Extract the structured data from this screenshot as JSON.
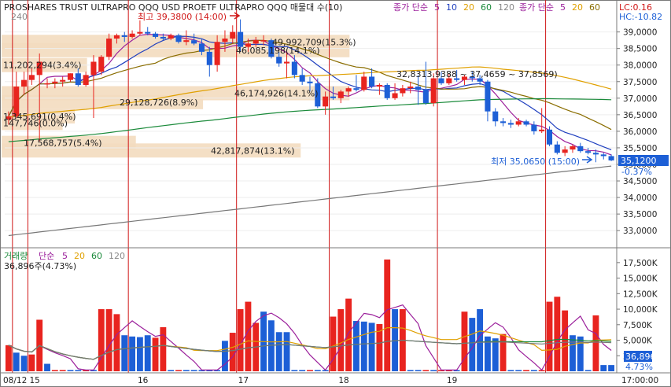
{
  "chart_data": {
    "type": "candlestick+volume",
    "instrument_title": "PROSHARES TRUST ULTRAPRO QQQ USD  PROETF ULTRAPRO QQQ 매물대 수(10)",
    "legend_price": [
      {
        "label": "종가 단순",
        "color": "#9b1f9b"
      },
      {
        "label": "5",
        "color": "#9b1f9b"
      },
      {
        "label": "10",
        "color": "#1f3fbf"
      },
      {
        "label": "20",
        "color": "#e0a000"
      },
      {
        "label": "60",
        "color": "#1a8a3a"
      },
      {
        "label": "120",
        "color": "#888888"
      },
      {
        "label": "240",
        "color": "#888888"
      }
    ],
    "legend_price_right": [
      {
        "label": "종가 단순",
        "color": "#9b1f9b"
      },
      {
        "label": "5",
        "color": "#9b1f9b"
      },
      {
        "label": "20",
        "color": "#e0a000"
      },
      {
        "label": "60",
        "color": "#8a6d00"
      }
    ],
    "lc_label": "LC:0.16",
    "hc_label": "HC:-10.82",
    "price_ylim": [
      32600,
      39300
    ],
    "price_ticks": [
      "39,0000",
      "38,5000",
      "38,0000",
      "37,5000",
      "37,0000",
      "36,5000",
      "36,0000",
      "35,5000",
      "35,0000",
      "34,5000",
      "34,0000",
      "33,5000",
      "33,0000"
    ],
    "price_tick_values": [
      39000,
      38500,
      38000,
      37500,
      37000,
      36500,
      36000,
      35500,
      35000,
      34500,
      34000,
      33500,
      33000
    ],
    "current_price": "35,1200",
    "current_change": "-0.37%",
    "high_label": "최고 39,3800 (14:00)",
    "low_label": "최저 35,0650 (15:00)",
    "range_label": "32,8313.9388 ~ 37,4659 ~ 37,8569)",
    "volume_profile": [
      {
        "label": "49,992,709(15.3%)",
        "price": 38700
      },
      {
        "label": "46,085,198(14.1%)",
        "price": 38450
      },
      {
        "label": "11,202,294(3.4%)",
        "price": 38000
      },
      {
        "label": "46,174,926(14.1%)",
        "price": 37150
      },
      {
        "label": "29,128,726(8.9%)",
        "price": 36880
      },
      {
        "label": "1,345,691(0.4%)",
        "price": 36450
      },
      {
        "label": "147,746(0.0%)",
        "price": 36250
      },
      {
        "label": "17,568,757(5.4%)",
        "price": 35650
      },
      {
        "label": "42,817,874(13.1%)",
        "price": 35420
      }
    ],
    "candles": [
      {
        "o": 36350,
        "h": 36600,
        "l": 36200,
        "c": 36450
      },
      {
        "o": 36450,
        "h": 37800,
        "l": 36400,
        "c": 37350
      },
      {
        "o": 37350,
        "h": 37800,
        "l": 37100,
        "c": 37550
      },
      {
        "o": 37550,
        "h": 37900,
        "l": 37400,
        "c": 37700
      },
      {
        "o": 37700,
        "h": 38350,
        "l": 35700,
        "c": 38100
      },
      {
        "o": 37450,
        "h": 37600,
        "l": 37300,
        "c": 37450
      },
      {
        "o": 37450,
        "h": 37600,
        "l": 37300,
        "c": 37500
      },
      {
        "o": 37500,
        "h": 37650,
        "l": 37350,
        "c": 37550
      },
      {
        "o": 37550,
        "h": 37750,
        "l": 37500,
        "c": 37750
      },
      {
        "o": 37750,
        "h": 37900,
        "l": 37350,
        "c": 37400
      },
      {
        "o": 37400,
        "h": 37800,
        "l": 37350,
        "c": 37700
      },
      {
        "o": 37700,
        "h": 38300,
        "l": 36400,
        "c": 38100
      },
      {
        "o": 37800,
        "h": 38300,
        "l": 37700,
        "c": 38250
      },
      {
        "o": 38250,
        "h": 38950,
        "l": 38150,
        "c": 38800
      },
      {
        "o": 38800,
        "h": 38950,
        "l": 38650,
        "c": 38900
      },
      {
        "o": 38900,
        "h": 39000,
        "l": 38700,
        "c": 38850
      },
      {
        "o": 38850,
        "h": 39050,
        "l": 38800,
        "c": 38950
      },
      {
        "o": 38950,
        "h": 39350,
        "l": 38900,
        "c": 39000
      },
      {
        "o": 39000,
        "h": 39150,
        "l": 38900,
        "c": 38950
      },
      {
        "o": 38950,
        "h": 39000,
        "l": 38800,
        "c": 38850
      },
      {
        "o": 38850,
        "h": 38950,
        "l": 38750,
        "c": 38800
      },
      {
        "o": 38800,
        "h": 38950,
        "l": 38750,
        "c": 38900
      },
      {
        "o": 38900,
        "h": 38950,
        "l": 38650,
        "c": 38700
      },
      {
        "o": 38700,
        "h": 39050,
        "l": 38600,
        "c": 38750
      },
      {
        "o": 38750,
        "h": 38950,
        "l": 38600,
        "c": 38650
      },
      {
        "o": 38650,
        "h": 38800,
        "l": 38300,
        "c": 38400
      },
      {
        "o": 38400,
        "h": 38550,
        "l": 37650,
        "c": 38000
      },
      {
        "o": 38000,
        "h": 38900,
        "l": 37800,
        "c": 38700
      },
      {
        "o": 38700,
        "h": 39050,
        "l": 38400,
        "c": 38800
      },
      {
        "o": 38800,
        "h": 39200,
        "l": 38650,
        "c": 39000
      },
      {
        "o": 39000,
        "h": 39380,
        "l": 38400,
        "c": 38550
      },
      {
        "o": 38550,
        "h": 38800,
        "l": 38400,
        "c": 38650
      },
      {
        "o": 38650,
        "h": 38850,
        "l": 38550,
        "c": 38750
      },
      {
        "o": 38750,
        "h": 38900,
        "l": 38600,
        "c": 38750
      },
      {
        "o": 38750,
        "h": 38800,
        "l": 38200,
        "c": 38250
      },
      {
        "o": 38250,
        "h": 38400,
        "l": 37950,
        "c": 38050
      },
      {
        "o": 38050,
        "h": 38400,
        "l": 37600,
        "c": 38100
      },
      {
        "o": 38100,
        "h": 38300,
        "l": 37600,
        "c": 37700
      },
      {
        "o": 37700,
        "h": 37900,
        "l": 37400,
        "c": 37500
      },
      {
        "o": 37500,
        "h": 37650,
        "l": 37200,
        "c": 37450
      },
      {
        "o": 37450,
        "h": 37600,
        "l": 36700,
        "c": 36750
      },
      {
        "o": 36750,
        "h": 37200,
        "l": 36500,
        "c": 37050
      },
      {
        "o": 37050,
        "h": 37350,
        "l": 36950,
        "c": 37000
      },
      {
        "o": 37000,
        "h": 37250,
        "l": 36850,
        "c": 37200
      },
      {
        "o": 37200,
        "h": 37350,
        "l": 37050,
        "c": 37300
      },
      {
        "o": 37300,
        "h": 37700,
        "l": 37200,
        "c": 37250
      },
      {
        "o": 37250,
        "h": 37800,
        "l": 37200,
        "c": 37650
      },
      {
        "o": 37650,
        "h": 37900,
        "l": 37300,
        "c": 37350
      },
      {
        "o": 37350,
        "h": 37450,
        "l": 37100,
        "c": 37400
      },
      {
        "o": 37400,
        "h": 37450,
        "l": 36950,
        "c": 37000
      },
      {
        "o": 37000,
        "h": 37450,
        "l": 36950,
        "c": 37150
      },
      {
        "o": 37150,
        "h": 37400,
        "l": 37050,
        "c": 37300
      },
      {
        "o": 37300,
        "h": 37500,
        "l": 37150,
        "c": 37350
      },
      {
        "o": 37350,
        "h": 37700,
        "l": 36800,
        "c": 37250
      },
      {
        "o": 37250,
        "h": 38100,
        "l": 36800,
        "c": 36850
      },
      {
        "o": 36850,
        "h": 37750,
        "l": 36750,
        "c": 37600
      },
      {
        "o": 37600,
        "h": 37800,
        "l": 37400,
        "c": 37450
      },
      {
        "o": 37450,
        "h": 37750,
        "l": 37400,
        "c": 37600
      },
      {
        "o": 37600,
        "h": 37850,
        "l": 37500,
        "c": 37550
      },
      {
        "o": 37550,
        "h": 37700,
        "l": 37400,
        "c": 37650
      },
      {
        "o": 37650,
        "h": 37800,
        "l": 37500,
        "c": 37600
      },
      {
        "o": 37600,
        "h": 37700,
        "l": 37400,
        "c": 37500
      },
      {
        "o": 37500,
        "h": 37550,
        "l": 36300,
        "c": 36600
      },
      {
        "o": 36600,
        "h": 36700,
        "l": 36150,
        "c": 36300
      },
      {
        "o": 36300,
        "h": 36400,
        "l": 36150,
        "c": 36250
      },
      {
        "o": 36250,
        "h": 36350,
        "l": 36100,
        "c": 36200
      },
      {
        "o": 36200,
        "h": 36400,
        "l": 36150,
        "c": 36300
      },
      {
        "o": 36300,
        "h": 36350,
        "l": 36150,
        "c": 36200
      },
      {
        "o": 36200,
        "h": 36300,
        "l": 35900,
        "c": 36000
      },
      {
        "o": 36000,
        "h": 36700,
        "l": 35950,
        "c": 36050
      },
      {
        "o": 36050,
        "h": 36150,
        "l": 35550,
        "c": 35600
      },
      {
        "o": 35600,
        "h": 35700,
        "l": 35300,
        "c": 35350
      },
      {
        "o": 35350,
        "h": 35550,
        "l": 35250,
        "c": 35450
      },
      {
        "o": 35450,
        "h": 35600,
        "l": 35350,
        "c": 35550
      },
      {
        "o": 35550,
        "h": 35650,
        "l": 35350,
        "c": 35400
      },
      {
        "o": 35400,
        "h": 35500,
        "l": 35300,
        "c": 35350
      },
      {
        "o": 35350,
        "h": 35450,
        "l": 35065,
        "c": 35300
      },
      {
        "o": 35300,
        "h": 35350,
        "l": 35150,
        "c": 35250
      },
      {
        "o": 35250,
        "h": 35300,
        "l": 35100,
        "c": 35120
      }
    ],
    "volume_legend": [
      {
        "label": "거래량",
        "color": "#1a8a3a"
      },
      {
        "label": "단순",
        "color": "#9b1f9b"
      },
      {
        "label": "5",
        "color": "#9b1f9b"
      },
      {
        "label": "20",
        "color": "#e0a000"
      },
      {
        "label": "60",
        "color": "#1a8a3a"
      },
      {
        "label": "120",
        "color": "#888888"
      }
    ],
    "volume_note": "36,896주(4.73%)",
    "volume_ylim": [
      0,
      19000
    ],
    "volume_ticks": [
      "17,500K",
      "15,000K",
      "12,500K",
      "10,000K",
      "7,500K",
      "5,000K",
      "2,500K"
    ],
    "volume_tick_values": [
      17500,
      15000,
      12500,
      10000,
      7500,
      5000,
      2500
    ],
    "current_volume": "36,896",
    "current_volume_pct": "4.73%",
    "volumes": [
      {
        "v": 4200,
        "up": true
      },
      {
        "v": 3000,
        "up": false
      },
      {
        "v": 2500,
        "up": false
      },
      {
        "v": 2700,
        "up": true
      },
      {
        "v": 8300,
        "up": true
      },
      {
        "v": 1200,
        "up": false
      },
      {
        "v": 200,
        "up": true
      },
      {
        "v": 200,
        "up": true
      },
      {
        "v": 200,
        "up": false
      },
      {
        "v": 200,
        "up": false
      },
      {
        "v": 200,
        "up": true
      },
      {
        "v": 200,
        "up": false
      },
      {
        "v": 10000,
        "up": true
      },
      {
        "v": 10000,
        "up": true
      },
      {
        "v": 9200,
        "up": true
      },
      {
        "v": 5800,
        "up": false
      },
      {
        "v": 5600,
        "up": false
      },
      {
        "v": 5500,
        "up": false
      },
      {
        "v": 5800,
        "up": false
      },
      {
        "v": 5400,
        "up": true
      },
      {
        "v": 7100,
        "up": true
      },
      {
        "v": 200,
        "up": false
      },
      {
        "v": 200,
        "up": true
      },
      {
        "v": 200,
        "up": false
      },
      {
        "v": 200,
        "up": false
      },
      {
        "v": 200,
        "up": false
      },
      {
        "v": 200,
        "up": false
      },
      {
        "v": 200,
        "up": false
      },
      {
        "v": 4900,
        "up": false
      },
      {
        "v": 6200,
        "up": true
      },
      {
        "v": 10000,
        "up": true
      },
      {
        "v": 11200,
        "up": true
      },
      {
        "v": 7800,
        "up": true
      },
      {
        "v": 9600,
        "up": false
      },
      {
        "v": 8200,
        "up": false
      },
      {
        "v": 6300,
        "up": false
      },
      {
        "v": 6300,
        "up": false
      },
      {
        "v": 200,
        "up": false
      },
      {
        "v": 200,
        "up": false
      },
      {
        "v": 200,
        "up": true
      },
      {
        "v": 200,
        "up": false
      },
      {
        "v": 200,
        "up": false
      },
      {
        "v": 8800,
        "up": true
      },
      {
        "v": 10000,
        "up": true
      },
      {
        "v": 11700,
        "up": true
      },
      {
        "v": 8100,
        "up": false
      },
      {
        "v": 8000,
        "up": false
      },
      {
        "v": 7800,
        "up": false
      },
      {
        "v": 7600,
        "up": true
      },
      {
        "v": 18000,
        "up": true
      },
      {
        "v": 10000,
        "up": false
      },
      {
        "v": 10000,
        "up": true
      },
      {
        "v": 200,
        "up": false
      },
      {
        "v": 200,
        "up": false
      },
      {
        "v": 200,
        "up": true
      },
      {
        "v": 200,
        "up": false
      },
      {
        "v": 200,
        "up": true
      },
      {
        "v": 200,
        "up": true
      },
      {
        "v": 200,
        "up": false
      },
      {
        "v": 9600,
        "up": true
      },
      {
        "v": 8600,
        "up": false
      },
      {
        "v": 10000,
        "up": false
      },
      {
        "v": 5600,
        "up": false
      },
      {
        "v": 5300,
        "up": false
      },
      {
        "v": 6000,
        "up": true
      },
      {
        "v": 200,
        "up": false
      },
      {
        "v": 200,
        "up": false
      },
      {
        "v": 200,
        "up": true
      },
      {
        "v": 200,
        "up": false
      },
      {
        "v": 200,
        "up": true
      },
      {
        "v": 11200,
        "up": true
      },
      {
        "v": 12000,
        "up": true
      },
      {
        "v": 9800,
        "up": true
      },
      {
        "v": 5800,
        "up": false
      },
      {
        "v": 5600,
        "up": false
      },
      {
        "v": 200,
        "up": false
      },
      {
        "v": 9000,
        "up": true
      },
      {
        "v": 1000,
        "up": false
      },
      {
        "v": 1000,
        "up": false
      }
    ],
    "x_labels": [
      "08/12",
      "15",
      "16",
      "17",
      "18",
      "19",
      "17:00:00"
    ],
    "day_separators": [
      1,
      3,
      16,
      30,
      42,
      56,
      70
    ],
    "x_label_index": [
      0,
      3,
      17,
      30,
      43,
      57
    ],
    "colors": {
      "up": "#e8241f",
      "down": "#1d5fd6",
      "ma5": "#9b1f9b",
      "ma10": "#1f3fbf",
      "ma20": "#e0a000",
      "ma60": "#1a8a3a",
      "ma120": "#777777",
      "ma20b": "#8a6d00",
      "band": "#f3dcbf",
      "sep": "#d01818",
      "price_box": "#1d5fd6"
    }
  }
}
